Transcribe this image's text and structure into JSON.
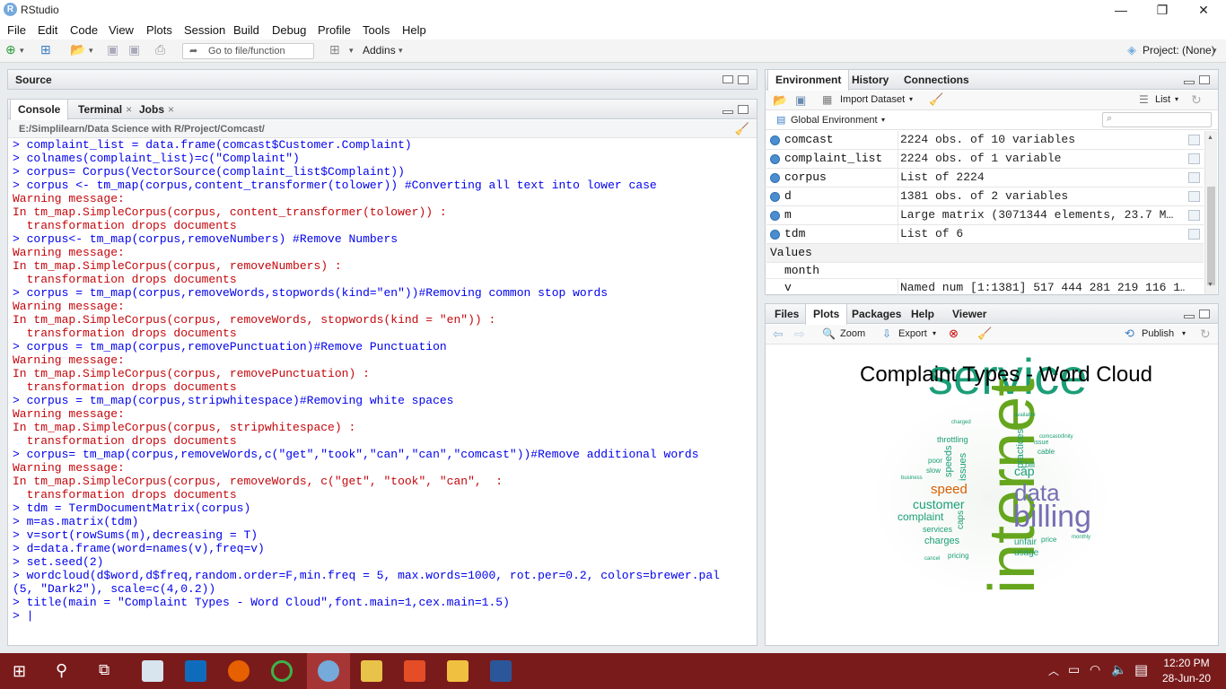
{
  "window": {
    "title": "RStudio",
    "minimize": "—",
    "restore": "❐",
    "close": "✕"
  },
  "menu": [
    "File",
    "Edit",
    "Code",
    "View",
    "Plots",
    "Session",
    "Build",
    "Debug",
    "Profile",
    "Tools",
    "Help"
  ],
  "toolbar": {
    "goto_placeholder": "Go to file/function",
    "addins": "Addins",
    "project": "Project: (None)"
  },
  "source_pane": {
    "title": "Source"
  },
  "console_pane": {
    "tabs": [
      "Console",
      "Terminal",
      "Jobs"
    ],
    "path": "E:/Simplilearn/Data Science with R/Project/Comcast/",
    "lines": [
      {
        "t": "cmd",
        "s": "> complaint_list = data.frame(comcast$Customer.Complaint)"
      },
      {
        "t": "cmd",
        "s": "> colnames(complaint_list)=c(\"Complaint\")"
      },
      {
        "t": "cmd",
        "s": "> corpus= Corpus(VectorSource(complaint_list$Complaint))"
      },
      {
        "t": "cmd",
        "s": "> corpus <- tm_map(corpus,content_transformer(tolower)) #Converting all text into lower case"
      },
      {
        "t": "wrn",
        "s": "Warning message:"
      },
      {
        "t": "wrn",
        "s": "In tm_map.SimpleCorpus(corpus, content_transformer(tolower)) :"
      },
      {
        "t": "wrn",
        "s": "  transformation drops documents"
      },
      {
        "t": "cmd",
        "s": "> corpus<- tm_map(corpus,removeNumbers) #Remove Numbers"
      },
      {
        "t": "wrn",
        "s": "Warning message:"
      },
      {
        "t": "wrn",
        "s": "In tm_map.SimpleCorpus(corpus, removeNumbers) :"
      },
      {
        "t": "wrn",
        "s": "  transformation drops documents"
      },
      {
        "t": "cmd",
        "s": "> corpus = tm_map(corpus,removeWords,stopwords(kind=\"en\"))#Removing common stop words"
      },
      {
        "t": "wrn",
        "s": "Warning message:"
      },
      {
        "t": "wrn",
        "s": "In tm_map.SimpleCorpus(corpus, removeWords, stopwords(kind = \"en\")) :"
      },
      {
        "t": "wrn",
        "s": "  transformation drops documents"
      },
      {
        "t": "cmd",
        "s": "> corpus = tm_map(corpus,removePunctuation)#Remove Punctuation"
      },
      {
        "t": "wrn",
        "s": "Warning message:"
      },
      {
        "t": "wrn",
        "s": "In tm_map.SimpleCorpus(corpus, removePunctuation) :"
      },
      {
        "t": "wrn",
        "s": "  transformation drops documents"
      },
      {
        "t": "cmd",
        "s": "> corpus = tm_map(corpus,stripwhitespace)#Removing white spaces"
      },
      {
        "t": "wrn",
        "s": "Warning message:"
      },
      {
        "t": "wrn",
        "s": "In tm_map.SimpleCorpus(corpus, stripwhitespace) :"
      },
      {
        "t": "wrn",
        "s": "  transformation drops documents"
      },
      {
        "t": "cmd",
        "s": "> corpus= tm_map(corpus,removeWords,c(\"get\",\"took\",\"can\",\"can\",\"comcast\"))#Remove additional words"
      },
      {
        "t": "wrn",
        "s": "Warning message:"
      },
      {
        "t": "wrn",
        "s": "In tm_map.SimpleCorpus(corpus, removeWords, c(\"get\", \"took\", \"can\",  :"
      },
      {
        "t": "wrn",
        "s": "  transformation drops documents"
      },
      {
        "t": "cmd",
        "s": "> tdm = TermDocumentMatrix(corpus)"
      },
      {
        "t": "cmd",
        "s": "> m=as.matrix(tdm)"
      },
      {
        "t": "cmd",
        "s": "> v=sort(rowSums(m),decreasing = T)"
      },
      {
        "t": "cmd",
        "s": "> d=data.frame(word=names(v),freq=v)"
      },
      {
        "t": "cmd",
        "s": "> set.seed(2)"
      },
      {
        "t": "cmd",
        "s": "> wordcloud(d$word,d$freq,random.order=F,min.freq = 5, max.words=1000, rot.per=0.2, colors=brewer.pal"
      },
      {
        "t": "cmd",
        "s": "(5, \"Dark2\"), scale=c(4,0.2))"
      },
      {
        "t": "cmd",
        "s": "> title(main = \"Complaint Types - Word Cloud\",font.main=1,cex.main=1.5)"
      },
      {
        "t": "cmd",
        "s": "> |"
      }
    ]
  },
  "env_pane": {
    "tabs": [
      "Environment",
      "History",
      "Connections"
    ],
    "import_label": "Import Dataset",
    "list_label": "List",
    "scope": "Global Environment",
    "rows": [
      {
        "name": "comcast",
        "value": "2224 obs. of 10 variables"
      },
      {
        "name": "complaint_list",
        "value": "2224 obs. of 1 variable"
      },
      {
        "name": "corpus",
        "value": "List of 2224"
      },
      {
        "name": "d",
        "value": "1381 obs. of 2 variables"
      },
      {
        "name": "m",
        "value": "Large matrix (3071344 elements, 23.7 M…"
      },
      {
        "name": "tdm",
        "value": "List of 6"
      }
    ],
    "values_header": "Values",
    "values": [
      {
        "name": "month",
        "value": ""
      },
      {
        "name": "v",
        "value": "Named num [1:1381] 517 444 281 219 116 1…"
      }
    ]
  },
  "files_pane": {
    "tabs": [
      "Files",
      "Plots",
      "Packages",
      "Help",
      "Viewer"
    ],
    "zoom": "Zoom",
    "export": "Export",
    "publish": "Publish",
    "plot_title": "Complaint Types - Word Cloud",
    "words": {
      "w1": "service",
      "w2": "internet",
      "w3": "billing",
      "w4": "data",
      "w5": "speed",
      "w6": "customer",
      "w7": "complaint",
      "w8": "charges",
      "w9": "speeds",
      "w10": "issues",
      "w11": "practices",
      "w12": "cap",
      "w13": "unfair",
      "w14": "usage",
      "w15": "caps",
      "w16": "throttling",
      "w17": "services",
      "w18": "bill",
      "w19": "poor",
      "w20": "slow",
      "w21": "pricing",
      "w22": "price",
      "w23": "cable",
      "w24": "issue",
      "w25": "monthly",
      "w26": "comcastxfinity",
      "w27": "available",
      "w28": "business",
      "w29": "charged",
      "w30": "cancel"
    }
  },
  "taskbar": {
    "time": "12:20 PM",
    "date": "28-Jun-20"
  }
}
